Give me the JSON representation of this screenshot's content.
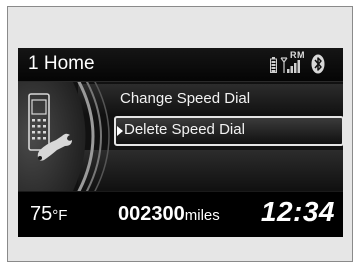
{
  "header": {
    "title": "1 Home"
  },
  "status": {
    "rm_label": "RM",
    "icons": [
      "battery-icon",
      "signal-strength-icon",
      "bluetooth-icon"
    ]
  },
  "menu": {
    "items": [
      {
        "label": "Change Speed Dial",
        "selected": false
      },
      {
        "label": "Delete Speed Dial",
        "selected": true
      }
    ]
  },
  "footer": {
    "temperature_value": "75",
    "temperature_unit": "°F",
    "odometer_value": "002300",
    "odometer_unit": "miles",
    "clock": "12:34"
  },
  "colors": {
    "screen_bg": "#000000",
    "text": "#ffffff",
    "frame_bg": "#e6e6e6"
  }
}
